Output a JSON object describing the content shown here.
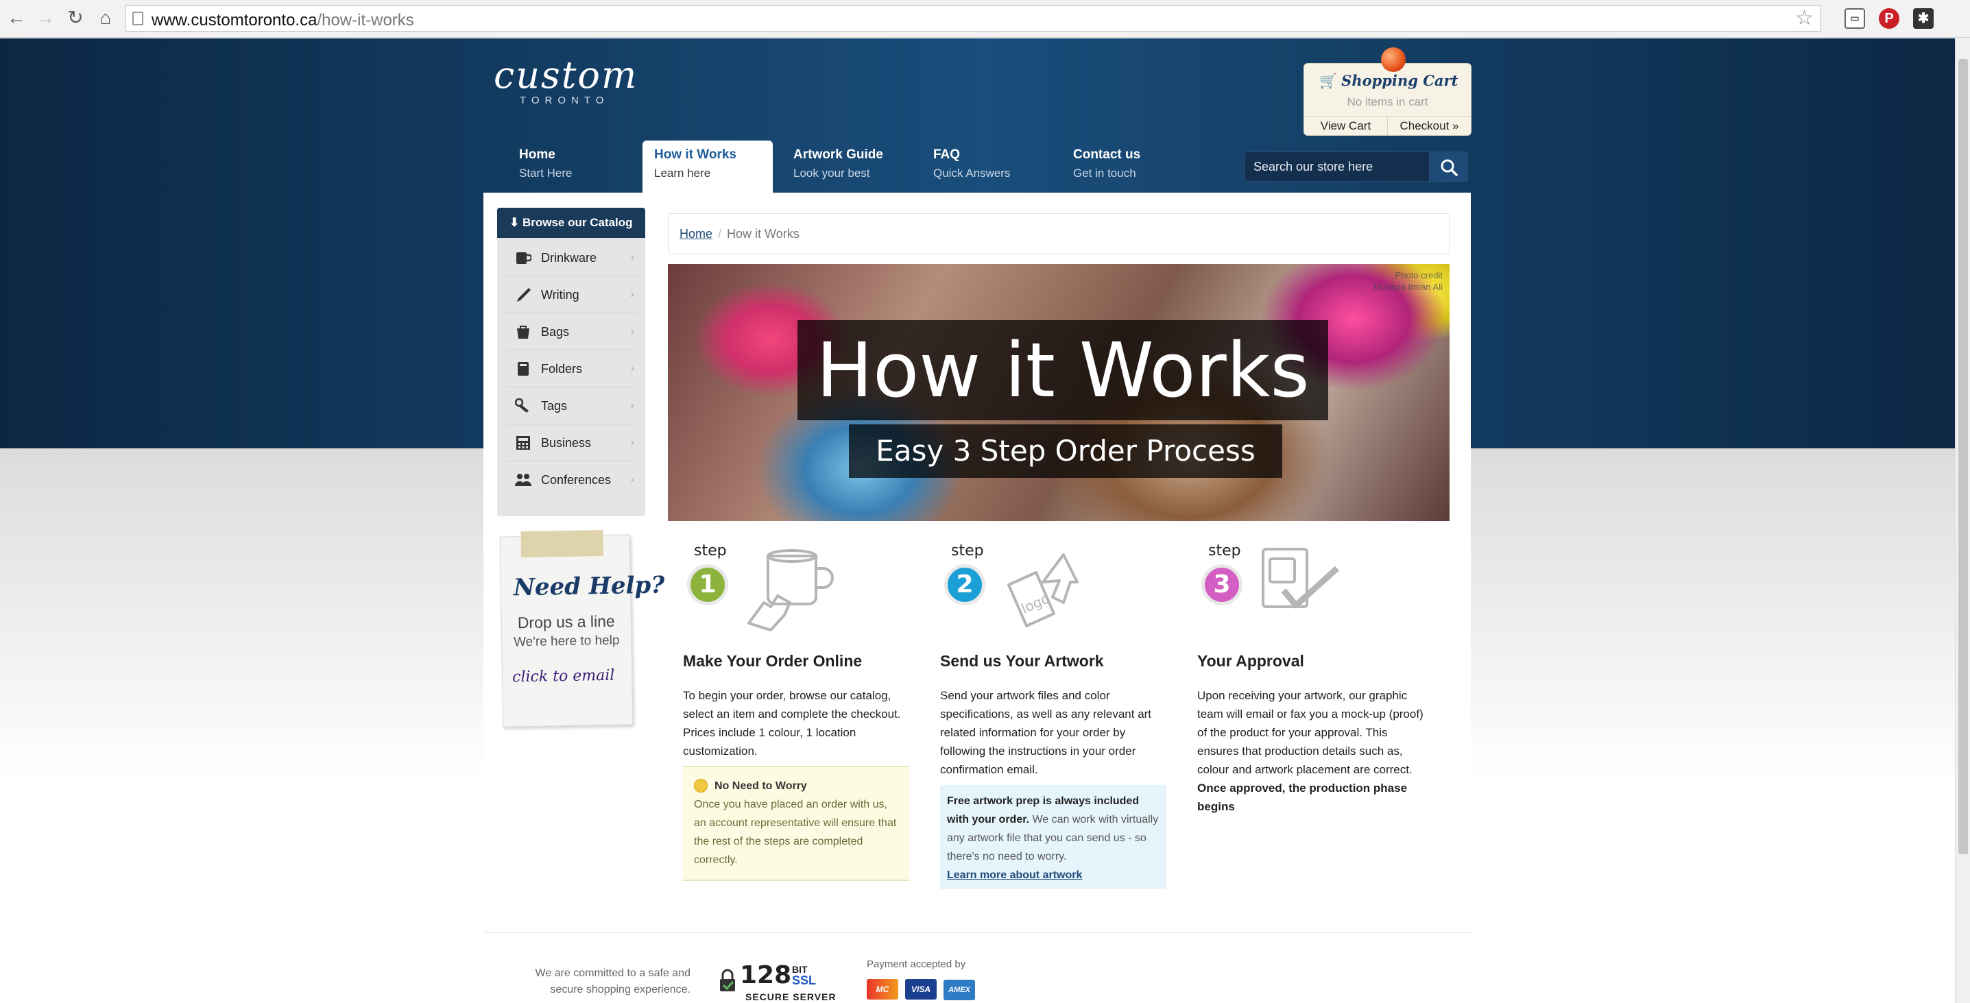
{
  "browser": {
    "url_domain": "www.customtoronto.ca",
    "url_path": "/how-it-works"
  },
  "header": {
    "logo_word": "custom",
    "logo_sub": "TORONTO",
    "cart": {
      "title": "Shopping Cart",
      "empty_text": "No items in cart",
      "view_cart": "View Cart",
      "checkout": "Checkout »"
    },
    "nav": [
      {
        "title": "Home",
        "subtitle": "Start Here",
        "active": false
      },
      {
        "title": "How it Works",
        "subtitle": "Learn here",
        "active": true
      },
      {
        "title": "Artwork Guide",
        "subtitle": "Look your best",
        "active": false
      },
      {
        "title": "FAQ",
        "subtitle": "Quick Answers",
        "active": false
      },
      {
        "title": "Contact us",
        "subtitle": "Get in touch",
        "active": false
      }
    ],
    "search_placeholder": "Search our store here"
  },
  "sidebar": {
    "catalog_title": "Browse our Catalog",
    "items": [
      {
        "label": "Drinkware",
        "icon": "mug-icon"
      },
      {
        "label": "Writing",
        "icon": "pen-icon"
      },
      {
        "label": "Bags",
        "icon": "bag-icon"
      },
      {
        "label": "Folders",
        "icon": "folder-icon"
      },
      {
        "label": "Tags",
        "icon": "tag-icon"
      },
      {
        "label": "Business",
        "icon": "calculator-icon"
      },
      {
        "label": "Conferences",
        "icon": "people-icon"
      }
    ],
    "help": {
      "title": "Need Help?",
      "line1": "Drop us a line",
      "line2": "We're here to help",
      "link": "click to email"
    }
  },
  "breadcrumb": {
    "home": "Home",
    "current": "How it Works"
  },
  "hero": {
    "credit_line1": "Photo credit",
    "credit_line2": "Murtaza Imran Ali",
    "title": "How it Works",
    "subtitle": "Easy 3 Step Order Process"
  },
  "steps": [
    {
      "label": "step",
      "number": "1",
      "color": "#8cb43c",
      "title": "Make Your Order Online",
      "text": "To begin your order, browse our catalog, select an item and complete the checkout. Prices include 1 colour, 1 location customization."
    },
    {
      "label": "step",
      "number": "2",
      "color": "#1a9fd6",
      "title": "Send us Your Artwork",
      "text": "Send your artwork files and color specifications, as well as any relevant art related information for your order by following the instructions in your order confirmation email."
    },
    {
      "label": "step",
      "number": "3",
      "color": "#d45fc4",
      "title": "Your Approval",
      "text": "Upon receiving your artwork, our graphic team will email or fax you a mock-up (proof) of the product for your approval. This ensures that production details such as, colour and artwork placement are correct.",
      "text_bold": "Once approved, the production phase begins"
    }
  ],
  "notes": {
    "worry_title": "No Need to Worry",
    "worry_text": "Once you have placed an order with us, an account representative will ensure that the rest of the steps are completed correctly.",
    "artwork_bold": "Free artwork prep is always included with your order.",
    "artwork_text": "We can work with virtually any artwork file that you can send us - so there's no need to worry.",
    "artwork_link": "Learn more about artwork"
  },
  "footer": {
    "commit_text": "We are committed to a safe and secure shopping experience.",
    "ssl_bits": "128",
    "ssl_bit": "BIT",
    "ssl_ssl": "SSL",
    "ssl_server": "SECURE SERVER",
    "payment_text": "Payment accepted by",
    "cards": [
      "MC",
      "VISA",
      "AMEX"
    ]
  }
}
